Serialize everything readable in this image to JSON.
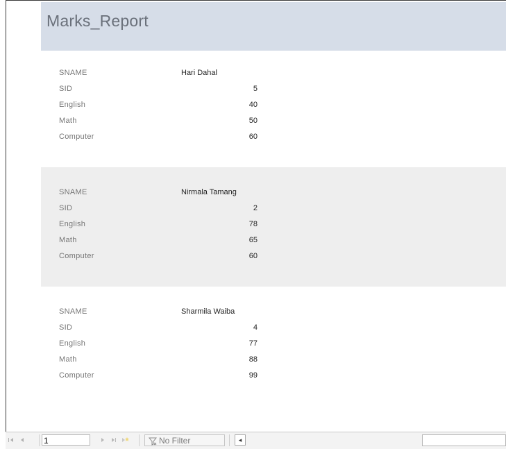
{
  "report": {
    "title": "Marks_Report",
    "records": [
      {
        "fields": [
          {
            "label": "SNAME",
            "value": "Hari Dahal",
            "kind": "text"
          },
          {
            "label": "SID",
            "value": "5",
            "kind": "num"
          },
          {
            "label": "English",
            "value": "40",
            "kind": "num"
          },
          {
            "label": "Math",
            "value": "50",
            "kind": "num"
          },
          {
            "label": "Computer",
            "value": "60",
            "kind": "num"
          }
        ]
      },
      {
        "fields": [
          {
            "label": "SNAME",
            "value": "Nirmala Tamang",
            "kind": "text"
          },
          {
            "label": "SID",
            "value": "2",
            "kind": "num"
          },
          {
            "label": "English",
            "value": "78",
            "kind": "num"
          },
          {
            "label": "Math",
            "value": "65",
            "kind": "num"
          },
          {
            "label": "Computer",
            "value": "60",
            "kind": "num"
          }
        ]
      },
      {
        "fields": [
          {
            "label": "SNAME",
            "value": "Sharmila Waiba",
            "kind": "text"
          },
          {
            "label": "SID",
            "value": "4",
            "kind": "num"
          },
          {
            "label": "English",
            "value": "77",
            "kind": "num"
          },
          {
            "label": "Math",
            "value": "88",
            "kind": "num"
          },
          {
            "label": "Computer",
            "value": "99",
            "kind": "num"
          }
        ]
      }
    ]
  },
  "navigation": {
    "first_icon": "first-record-icon",
    "prev_icon": "previous-record-icon",
    "current_record": "1",
    "next_icon": "next-record-icon",
    "last_icon": "last-record-icon",
    "new_icon": "new-record-icon",
    "filter_label": "No Filter",
    "scroll_left_icon": "scroll-left-icon"
  }
}
